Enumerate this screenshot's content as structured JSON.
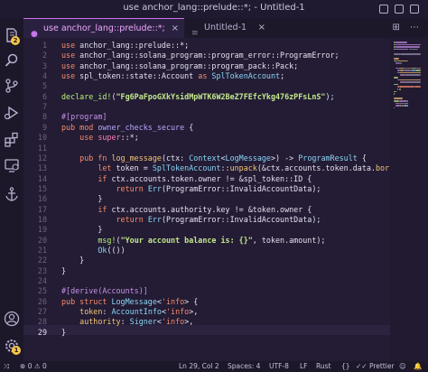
{
  "window": {
    "title": "use anchor_lang::prelude::*; - Untitled-1"
  },
  "activity_bar": {
    "items": [
      {
        "name": "explorer-icon",
        "badge": "2"
      },
      {
        "name": "search-icon"
      },
      {
        "name": "source-control-icon"
      },
      {
        "name": "run-debug-icon"
      },
      {
        "name": "extensions-icon"
      },
      {
        "name": "remote-explorer-icon"
      },
      {
        "name": "anchor-icon"
      }
    ],
    "bottom": [
      {
        "name": "account-icon"
      },
      {
        "name": "settings-gear-icon",
        "badge": "1"
      }
    ]
  },
  "tabs": [
    {
      "label": "use anchor_lang::prelude::*;",
      "active": true
    },
    {
      "label": "Untitled-1",
      "active": false
    }
  ],
  "tab_close": "×",
  "tab_actions": "⊞ ⋯",
  "editor": {
    "current_line": 29,
    "lines": [
      {
        "n": "1",
        "t": [
          [
            "kw",
            "use "
          ],
          [
            "pl",
            "anchor_lang::prelude::*;"
          ]
        ]
      },
      {
        "n": "2",
        "t": [
          [
            "kw",
            "use "
          ],
          [
            "pl",
            "anchor_lang::solana_program::program_error::ProgramError;"
          ]
        ]
      },
      {
        "n": "3",
        "t": [
          [
            "kw",
            "use "
          ],
          [
            "pl",
            "anchor_lang::solana_program::program_pack::Pack;"
          ]
        ]
      },
      {
        "n": "4",
        "t": [
          [
            "kw",
            "use "
          ],
          [
            "pl",
            "spl_token::state::Account "
          ],
          [
            "kw",
            "as "
          ],
          [
            "ty",
            "SplTokenAccount"
          ],
          [
            "pl",
            ";"
          ]
        ]
      },
      {
        "n": "5",
        "t": []
      },
      {
        "n": "6",
        "t": [
          [
            "macro",
            "declare_id!"
          ],
          [
            "pl",
            "("
          ],
          [
            "str",
            "\"Fg6PaFpoGXkYsidMpWTK6W2BeZ7FEfcYkg476zPFsLnS\""
          ],
          [
            "pl",
            ");"
          ]
        ]
      },
      {
        "n": "7",
        "t": []
      },
      {
        "n": "8",
        "t": [
          [
            "attr",
            "#[program]"
          ]
        ]
      },
      {
        "n": "9",
        "t": [
          [
            "kw",
            "pub mod "
          ],
          [
            "mod",
            "owner_checks_secure"
          ],
          [
            "pl",
            " {"
          ]
        ]
      },
      {
        "n": "10",
        "t": [
          [
            "pl",
            "    "
          ],
          [
            "kw",
            "use "
          ],
          [
            "kw2",
            "super"
          ],
          [
            "pl",
            "::*;"
          ]
        ]
      },
      {
        "n": "11",
        "t": []
      },
      {
        "n": "12",
        "t": [
          [
            "pl",
            "    "
          ],
          [
            "kw",
            "pub fn "
          ],
          [
            "fn",
            "log_message"
          ],
          [
            "pl",
            "(ctx: "
          ],
          [
            "ty",
            "Context"
          ],
          [
            "pl",
            "<"
          ],
          [
            "ty",
            "LogMessage"
          ],
          [
            "pl",
            ">) -> "
          ],
          [
            "ty",
            "ProgramResult"
          ],
          [
            "pl",
            " {"
          ]
        ]
      },
      {
        "n": "13",
        "t": [
          [
            "pl",
            "        "
          ],
          [
            "kw",
            "let "
          ],
          [
            "pl",
            "token = "
          ],
          [
            "ty",
            "SplTokenAccount"
          ],
          [
            "pl",
            "::"
          ],
          [
            "fn",
            "unpack"
          ],
          [
            "pl",
            "(&ctx.accounts.token.data."
          ],
          [
            "fn",
            "borrow"
          ],
          [
            "pl",
            "())?;"
          ]
        ]
      },
      {
        "n": "14",
        "t": [
          [
            "pl",
            "        "
          ],
          [
            "kw",
            "if "
          ],
          [
            "pl",
            "ctx.accounts.token.owner != &spl_token::ID {"
          ]
        ]
      },
      {
        "n": "15",
        "t": [
          [
            "pl",
            "            "
          ],
          [
            "kw",
            "return "
          ],
          [
            "ty",
            "Err"
          ],
          [
            "pl",
            "(ProgramError::InvalidAccountData);"
          ]
        ]
      },
      {
        "n": "16",
        "t": [
          [
            "pl",
            "        }"
          ]
        ]
      },
      {
        "n": "17",
        "t": [
          [
            "pl",
            "        "
          ],
          [
            "kw",
            "if "
          ],
          [
            "pl",
            "ctx.accounts.authority.key != &token.owner {"
          ]
        ]
      },
      {
        "n": "18",
        "t": [
          [
            "pl",
            "            "
          ],
          [
            "kw",
            "return "
          ],
          [
            "ty",
            "Err"
          ],
          [
            "pl",
            "(ProgramError::InvalidAccountData);"
          ]
        ]
      },
      {
        "n": "19",
        "t": [
          [
            "pl",
            "        }"
          ]
        ]
      },
      {
        "n": "20",
        "t": [
          [
            "pl",
            "        "
          ],
          [
            "macro",
            "msg!"
          ],
          [
            "pl",
            "("
          ],
          [
            "str",
            "\"Your account balance is: {}\""
          ],
          [
            "pl",
            ", token.amount);"
          ]
        ]
      },
      {
        "n": "21",
        "t": [
          [
            "pl",
            "        "
          ],
          [
            "ty",
            "Ok"
          ],
          [
            "pl",
            "(())"
          ]
        ]
      },
      {
        "n": "22",
        "t": [
          [
            "pl",
            "    }"
          ]
        ]
      },
      {
        "n": "23",
        "t": [
          [
            "pl",
            "}"
          ]
        ]
      },
      {
        "n": "24",
        "t": []
      },
      {
        "n": "25",
        "t": [
          [
            "attr",
            "#[derive(Accounts)]"
          ]
        ]
      },
      {
        "n": "26",
        "t": [
          [
            "kw",
            "pub struct "
          ],
          [
            "ty",
            "LogMessage"
          ],
          [
            "pl",
            "<"
          ],
          [
            "lt",
            "'info"
          ],
          [
            "pl",
            "> {"
          ]
        ]
      },
      {
        "n": "27",
        "t": [
          [
            "pl",
            "    "
          ],
          [
            "fn",
            "token"
          ],
          [
            "pl",
            ": "
          ],
          [
            "ty",
            "AccountInfo"
          ],
          [
            "pl",
            "<"
          ],
          [
            "lt",
            "'info"
          ],
          [
            "pl",
            ">,"
          ]
        ]
      },
      {
        "n": "28",
        "t": [
          [
            "pl",
            "    "
          ],
          [
            "fn",
            "authority"
          ],
          [
            "pl",
            ": "
          ],
          [
            "ty",
            "Signer"
          ],
          [
            "pl",
            "<"
          ],
          [
            "lt",
            "'info"
          ],
          [
            "pl",
            ">,"
          ]
        ]
      },
      {
        "n": "29",
        "t": [
          [
            "pl",
            "}"
          ]
        ]
      }
    ]
  },
  "status_bar": {
    "errors": "0",
    "warnings": "0",
    "position": "Ln 29, Col 2",
    "spaces": "Spaces: 4",
    "encoding": "UTF-8",
    "eol": "LF",
    "language": "Rust",
    "prettier": "Prettier"
  },
  "colors": {
    "accent": "#c774e8",
    "background": "#231c34",
    "keyword": "#f78c6c",
    "string": "#c3e88d",
    "type": "#8bd5f6",
    "function": "#f5c67a"
  }
}
